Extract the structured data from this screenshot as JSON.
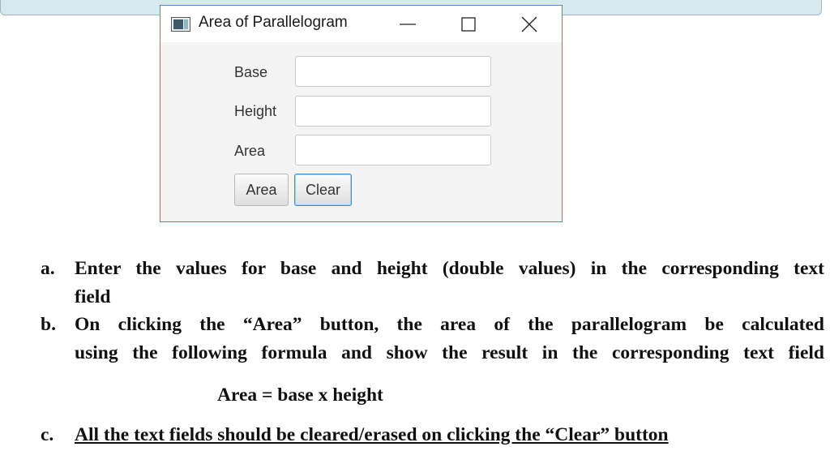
{
  "window": {
    "title": "Area of Parallelogram",
    "controls": {
      "minimize": "minimize",
      "maximize": "maximize",
      "close": "close"
    }
  },
  "form": {
    "base_label": "Base",
    "height_label": "Height",
    "area_label": "Area",
    "base_value": "",
    "height_value": "",
    "area_value": "",
    "area_button": "Area",
    "clear_button": "Clear"
  },
  "instructions": {
    "a_marker": "a.",
    "a_line1": "Enter the values for base and height (double values) in the corresponding text",
    "a_line2": "field",
    "b_marker": "b.",
    "b_line1": "On clicking the “Area” button, the area of the parallelogram be calculated",
    "b_line2": "using the following formula and show the result in the corresponding text field",
    "formula": "Area = base x height",
    "c_marker": "c.",
    "c_line1": "All the text fields should be cleared/erased on clicking the “Clear” button"
  },
  "colors": {
    "window_border": "#4f87c9",
    "clear_focus": "#3b8fd8"
  }
}
